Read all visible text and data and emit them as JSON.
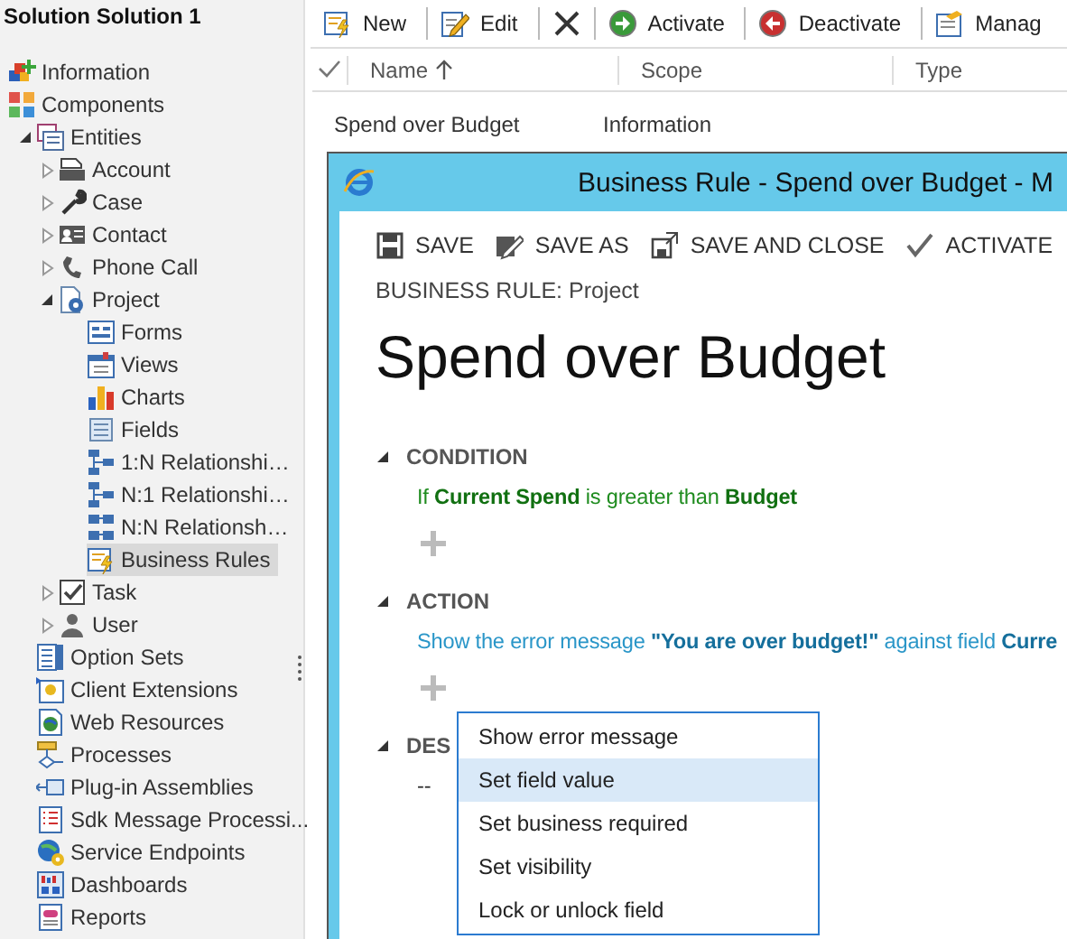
{
  "sidebar": {
    "title": "Solution Solution 1",
    "items": [
      {
        "label": "Information",
        "selected": false
      },
      {
        "label": "Components",
        "selected": false,
        "children": [
          {
            "label": "Entities",
            "selected": false,
            "expanded": true,
            "children": [
              {
                "label": "Account",
                "selected": false,
                "expanded": false
              },
              {
                "label": "Case",
                "selected": false,
                "expanded": false
              },
              {
                "label": "Contact",
                "selected": false,
                "expanded": false
              },
              {
                "label": "Phone Call",
                "selected": false,
                "expanded": false
              },
              {
                "label": "Project",
                "selected": false,
                "expanded": true,
                "children": [
                  {
                    "label": "Forms",
                    "selected": false
                  },
                  {
                    "label": "Views",
                    "selected": false
                  },
                  {
                    "label": "Charts",
                    "selected": false
                  },
                  {
                    "label": "Fields",
                    "selected": false
                  },
                  {
                    "label": "1:N Relationshi…",
                    "selected": false
                  },
                  {
                    "label": "N:1 Relationshi…",
                    "selected": false
                  },
                  {
                    "label": "N:N Relationsh…",
                    "selected": false
                  },
                  {
                    "label": "Business Rules",
                    "selected": true
                  }
                ]
              },
              {
                "label": "Task",
                "selected": false,
                "expanded": false
              },
              {
                "label": "User",
                "selected": false,
                "expanded": false
              }
            ]
          },
          {
            "label": "Option Sets",
            "selected": false
          },
          {
            "label": "Client Extensions",
            "selected": false
          },
          {
            "label": "Web Resources",
            "selected": false
          },
          {
            "label": "Processes",
            "selected": false
          },
          {
            "label": "Plug-in Assemblies",
            "selected": false
          },
          {
            "label": "Sdk Message Processi...",
            "selected": false
          },
          {
            "label": "Service Endpoints",
            "selected": false
          },
          {
            "label": "Dashboards",
            "selected": false
          },
          {
            "label": "Reports",
            "selected": false
          }
        ]
      }
    ]
  },
  "toolbar": [
    {
      "kind": "text",
      "label": "New"
    },
    {
      "kind": "text",
      "label": "Edit"
    },
    {
      "kind": "icon"
    },
    {
      "kind": "text",
      "label": "Activate"
    },
    {
      "kind": "text",
      "label": "Deactivate"
    },
    {
      "kind": "text",
      "label": "Manag"
    }
  ],
  "table": {
    "columns": [
      {
        "label": "Name",
        "sorted": true
      },
      {
        "label": "Scope",
        "sorted": false
      },
      {
        "label": "Type",
        "sorted": false
      }
    ],
    "rows": [
      {
        "cells": [
          "Spend over Budget",
          "Information"
        ]
      }
    ]
  },
  "dialog": {
    "title": "Business Rule - Spend over Budget - M",
    "commands": [
      "SAVE",
      "SAVE AS",
      "SAVE AND CLOSE",
      "ACTIVATE"
    ],
    "entity_label": "BUSINESS RULE: Project",
    "name": "Spend over Budget",
    "sections": [
      {
        "kind": "condition",
        "heading": "CONDITION",
        "expanded": true,
        "text": "If **Current Spend** is greater than **Budget**",
        "can_add": true
      },
      {
        "kind": "action",
        "heading": "ACTION",
        "expanded": true,
        "text": "Show the error message **\"You are over budget!\"** against field **Curre**",
        "can_add": true
      },
      {
        "kind": "description",
        "heading": "DES",
        "expanded": true,
        "text": "--",
        "can_add": false
      }
    ],
    "menu": [
      {
        "label": "Show error message",
        "selected": false
      },
      {
        "label": "Set field value",
        "selected": true
      },
      {
        "label": "Set business required",
        "selected": false
      },
      {
        "label": "Set visibility",
        "selected": false
      },
      {
        "label": "Lock or unlock field",
        "selected": false
      }
    ]
  }
}
